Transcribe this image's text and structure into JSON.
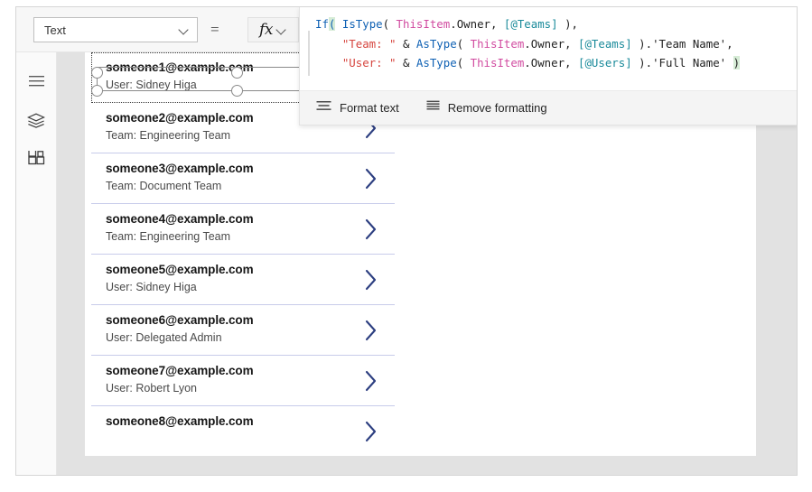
{
  "top_bar": {
    "property_select": {
      "value": "Text",
      "icon": "chevron-down-icon"
    },
    "equals": "=",
    "fx_button": {
      "label": "fx",
      "icon": "chevron-down-icon"
    }
  },
  "left_rail": {
    "items": [
      {
        "name": "hamburger-menu-icon",
        "label": "Menu"
      },
      {
        "name": "tree-view-icon",
        "label": "Tree view"
      },
      {
        "name": "components-icon",
        "label": "Insert"
      }
    ]
  },
  "formula_bar": {
    "lines": [
      [
        {
          "t": "If",
          "c": "fn"
        },
        {
          "t": "(",
          "c": "paren-hi"
        },
        {
          "t": " ",
          "c": "pn"
        },
        {
          "t": "IsType",
          "c": "fn"
        },
        {
          "t": "( ",
          "c": "pn"
        },
        {
          "t": "ThisItem",
          "c": "obj"
        },
        {
          "t": ".Owner, ",
          "c": "prop"
        },
        {
          "t": "[@Teams]",
          "c": "scope"
        },
        {
          "t": " ),",
          "c": "pn"
        }
      ],
      [
        {
          "t": "    ",
          "c": "pn"
        },
        {
          "t": "\"Team: \"",
          "c": "str"
        },
        {
          "t": " & ",
          "c": "op"
        },
        {
          "t": "AsType",
          "c": "fn"
        },
        {
          "t": "( ",
          "c": "pn"
        },
        {
          "t": "ThisItem",
          "c": "obj"
        },
        {
          "t": ".Owner, ",
          "c": "prop"
        },
        {
          "t": "[@Teams]",
          "c": "scope"
        },
        {
          "t": " ).",
          "c": "pn"
        },
        {
          "t": "'Team Name'",
          "c": "prop"
        },
        {
          "t": ",",
          "c": "pn"
        }
      ],
      [
        {
          "t": "    ",
          "c": "pn"
        },
        {
          "t": "\"User: \"",
          "c": "str"
        },
        {
          "t": " & ",
          "c": "op"
        },
        {
          "t": "AsType",
          "c": "fn"
        },
        {
          "t": "( ",
          "c": "pn"
        },
        {
          "t": "ThisItem",
          "c": "obj"
        },
        {
          "t": ".Owner, ",
          "c": "prop"
        },
        {
          "t": "[@Users]",
          "c": "scope"
        },
        {
          "t": " ).",
          "c": "pn"
        },
        {
          "t": "'Full Name'",
          "c": "prop"
        },
        {
          "t": " ",
          "c": "pn"
        },
        {
          "t": ")",
          "c": "paren-hi2"
        }
      ]
    ],
    "toolbar": [
      {
        "label": "Format text",
        "icon": "format-text-icon"
      },
      {
        "label": "Remove formatting",
        "icon": "remove-formatting-icon"
      }
    ]
  },
  "gallery": {
    "items": [
      {
        "title": "someone1@example.com",
        "subtitle": "User: Sidney Higa",
        "selected": true,
        "chevron": "chevron-right-icon"
      },
      {
        "title": "someone2@example.com",
        "subtitle": "Team: Engineering Team",
        "selected": false,
        "chevron": "chevron-right-icon"
      },
      {
        "title": "someone3@example.com",
        "subtitle": "Team: Document Team",
        "selected": false,
        "chevron": "chevron-right-icon"
      },
      {
        "title": "someone4@example.com",
        "subtitle": "Team: Engineering Team",
        "selected": false,
        "chevron": "chevron-right-icon"
      },
      {
        "title": "someone5@example.com",
        "subtitle": "User: Sidney Higa",
        "selected": false,
        "chevron": "chevron-right-icon"
      },
      {
        "title": "someone6@example.com",
        "subtitle": "User: Delegated Admin",
        "selected": false,
        "chevron": "chevron-right-icon"
      },
      {
        "title": "someone7@example.com",
        "subtitle": "User: Robert Lyon",
        "selected": false,
        "chevron": "chevron-right-icon"
      },
      {
        "title": "someone8@example.com",
        "subtitle": "",
        "selected": false,
        "chevron": "chevron-right-icon"
      }
    ]
  },
  "colors": {
    "chevron": "#2c3e80",
    "separator": "#c8ccea",
    "workspace": "#e2e2e2",
    "canvas": "#ffffff",
    "function_token": "#0f61b4",
    "object_token": "#d14ba0",
    "string_token": "#d6453f",
    "scope_token": "#1a8a9a"
  }
}
